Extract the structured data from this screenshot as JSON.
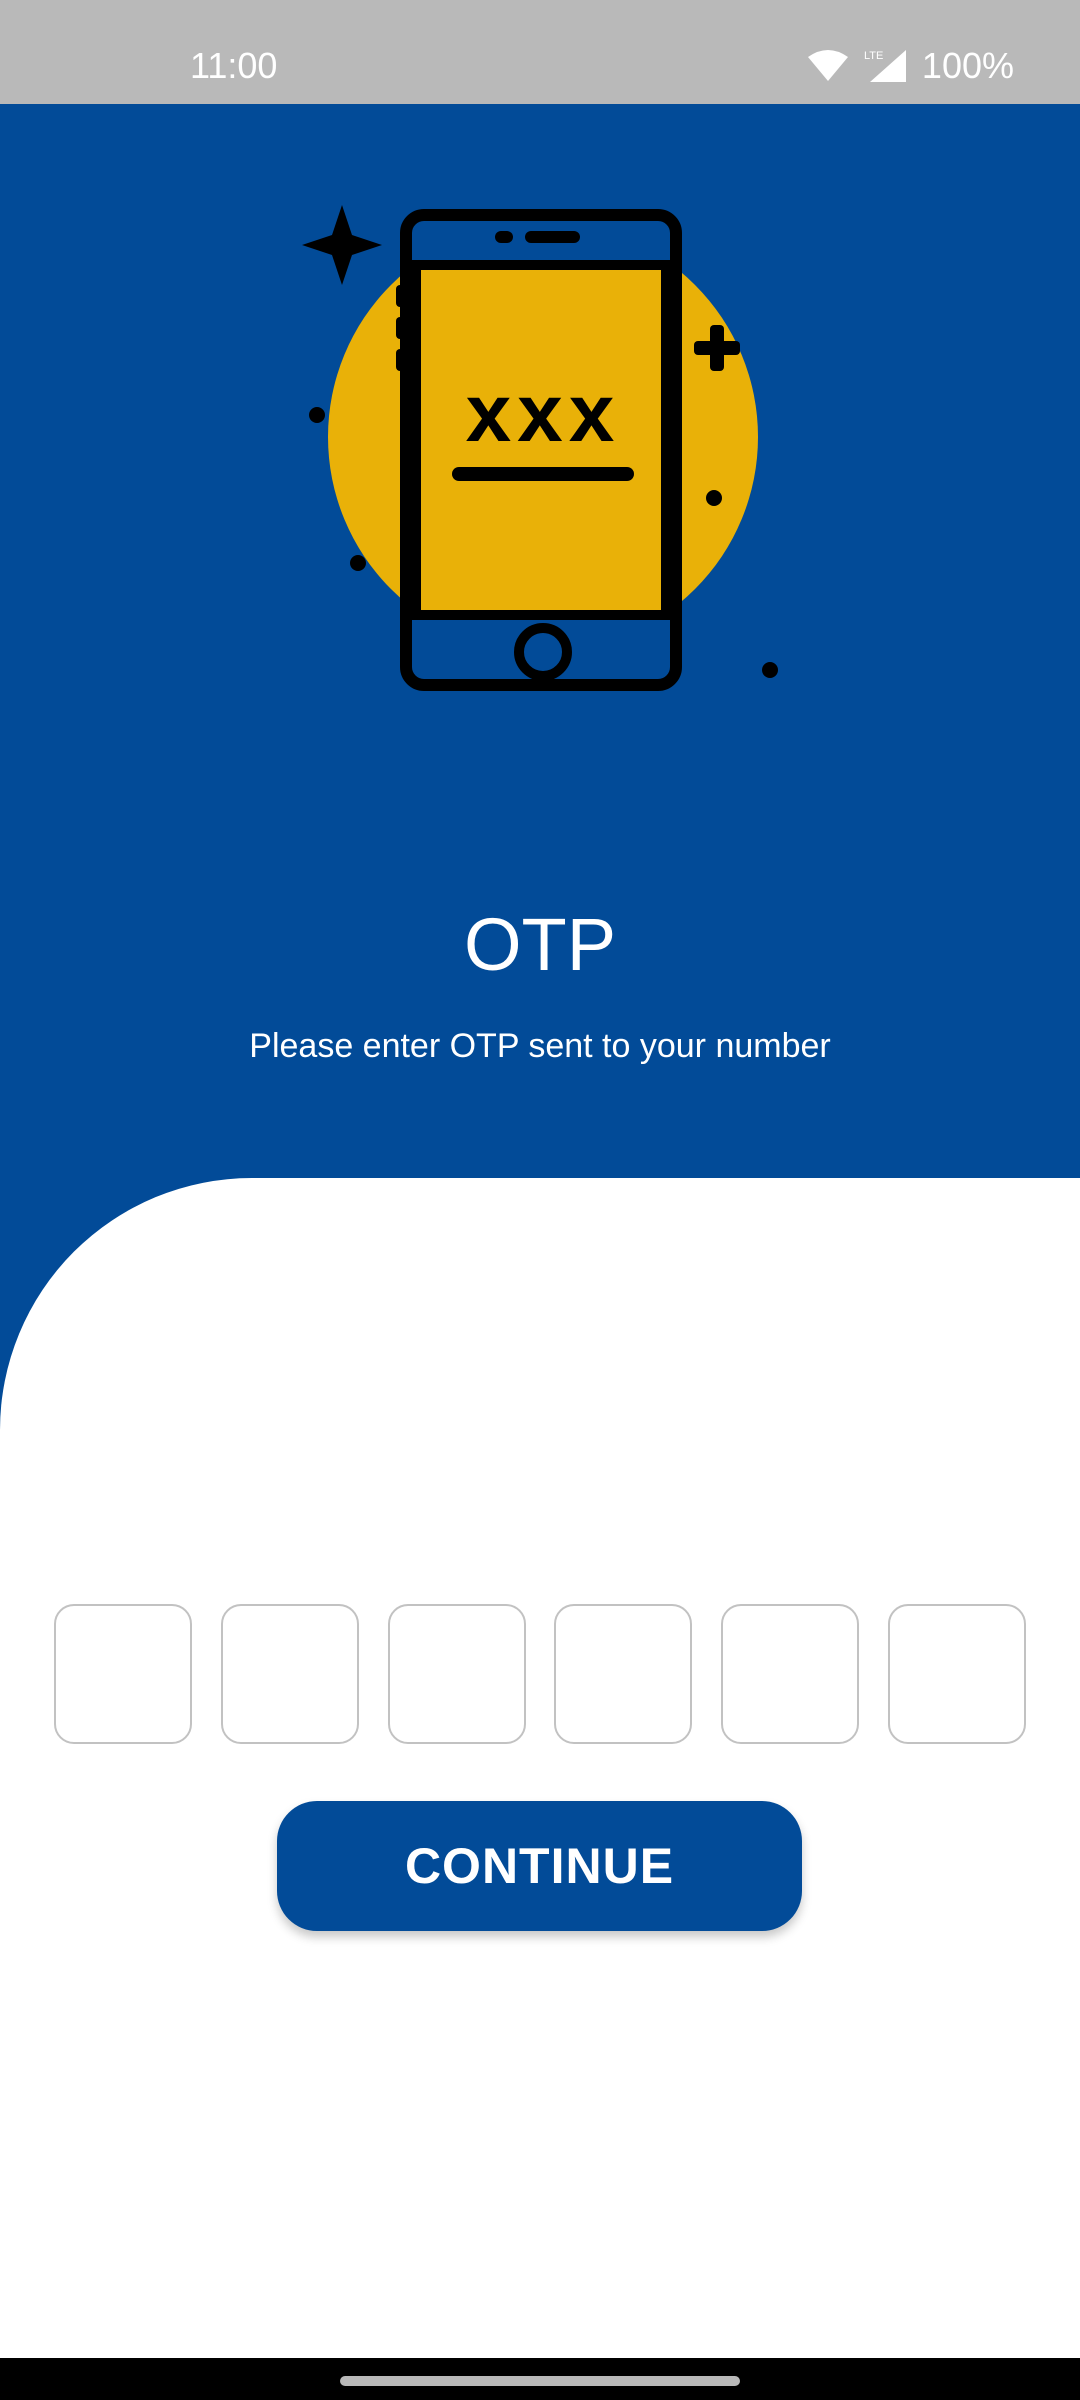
{
  "status_bar": {
    "time": "11:00",
    "network_label": "LTE",
    "battery": "100%",
    "icons": [
      "wifi-icon",
      "cell-signal-icon"
    ]
  },
  "illustration": {
    "icon": "phone-otp-icon",
    "screen_text": "xxx"
  },
  "header": {
    "title": "OTP",
    "subtitle": "Please enter OTP sent to your number"
  },
  "otp": {
    "digits": [
      "",
      "",
      "",
      "",
      "",
      ""
    ]
  },
  "actions": {
    "continue_label": "CONTINUE"
  },
  "colors": {
    "primary": "#024b98",
    "accent": "#e9b108",
    "status_bar": "#b9b9b9",
    "input_border": "#c2c2c2"
  }
}
